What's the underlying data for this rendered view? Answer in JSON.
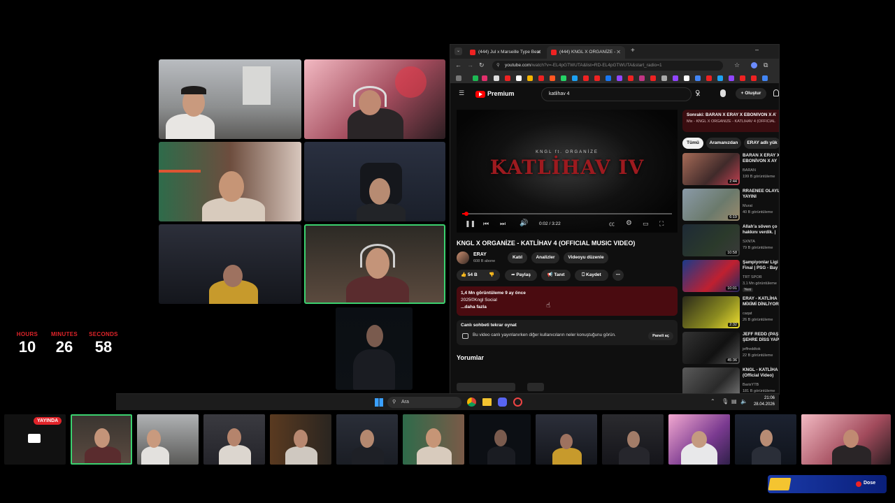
{
  "countdown": {
    "hours_label": "HOURS",
    "hours": "10",
    "minutes_label": "MINUTES",
    "minutes": "26",
    "seconds_label": "SECONDS",
    "seconds": "58"
  },
  "browser": {
    "tabs": [
      {
        "title": "(444) Jul x Marseille Type Beat",
        "active": false
      },
      {
        "title": "(444) KNGL X ORGANİZE -",
        "active": true
      }
    ],
    "url_host": "youtube.com",
    "url_path": "/watch?v=-EL4pGTWUTA&list=RD-EL4pGTWUTA&start_radio=1"
  },
  "youtube": {
    "logo": "Premium",
    "search_value": "katlihav 4",
    "create_label": "Oluştur",
    "player": {
      "overlay_top": "KNGL ft. ORGANİZE",
      "overlay_big": "KATLİHAV IV",
      "time": "0:02 / 3:22",
      "progress": 0.01
    },
    "video_title": "KNGL X ORGANİZE - KATLİHAV 4 (OFFICIAL MUSIC VIDEO)",
    "channel": {
      "name": "ERAY",
      "subs": "608 B abone"
    },
    "buttons": {
      "join": "Katıl",
      "analytics": "Analizler",
      "edit": "Videoyu düzenle"
    },
    "actions": {
      "likes": "54 B",
      "share": "Paylaş",
      "promote": "Tanıt",
      "save": "Kaydet"
    },
    "description": {
      "line1": "1,4 Mn görüntüleme  9 ay önce",
      "line2": "2025©Kngl Social",
      "more": "...daha fazla"
    },
    "chat_replay": {
      "title": "Canlı sohbeti tekrar oynat",
      "body": "Bu video canlı yayınlanırken diğer kullanıcıların neler konuştuğunu görün.",
      "button": "Paneli aç"
    },
    "comments_heading": "Yorumlar",
    "playlist": {
      "next": "Sonraki: BARAN X ERAY X EBONİVON X AY",
      "sub": "Mix - KNGL X ORGANİZE - KATLİHAV 4 (OFFICIAL"
    },
    "filter_chips": [
      "Tümü",
      "Aramanızdan",
      "ERAY adlı yük"
    ],
    "sidebar": [
      {
        "title": "BARAN X ERAY X EBONİVON X AY",
        "channel": "BARAN",
        "meta": "199 B görüntüleme",
        "duration": "2:44"
      },
      {
        "title": "RRAENEE OLAYLI YAYINI",
        "channel": "Murat",
        "meta": "40 B görüntüleme",
        "duration": "6:19"
      },
      {
        "title": "Allah'a söven ço hakkını verdik. |",
        "channel": "SXNTA",
        "meta": "79 B görüntüleme",
        "duration": "10:58"
      },
      {
        "title": "Şampiyonlar Ligi Final | PSG - Bay",
        "channel": "TRT SPOR",
        "meta": "3,1 Mn görüntüleme",
        "duration": "10:01",
        "badge": "Yeni"
      },
      {
        "title": "ERAY - KATLİHA MİXİMİ DİNLİYOR",
        "channel": "caqat",
        "meta": "26 B görüntüleme",
        "duration": "2:32"
      },
      {
        "title": "JEFF REDD (PAŞ ŞEHRE DİSS YAP",
        "channel": "jeffreddtok",
        "meta": "22 B görüntüleme",
        "duration": "45:36"
      },
      {
        "title": "KNGL - KATLİHA (Official Video)",
        "channel": "BarisYTB",
        "meta": "181 B görüntüleme",
        "duration": ""
      }
    ]
  },
  "taskbar": {
    "search_placeholder": "Ara",
    "time": "21:06",
    "date": "28.04.2026"
  },
  "live_badge": "YAYINDA",
  "overlay_brand": "Dose"
}
